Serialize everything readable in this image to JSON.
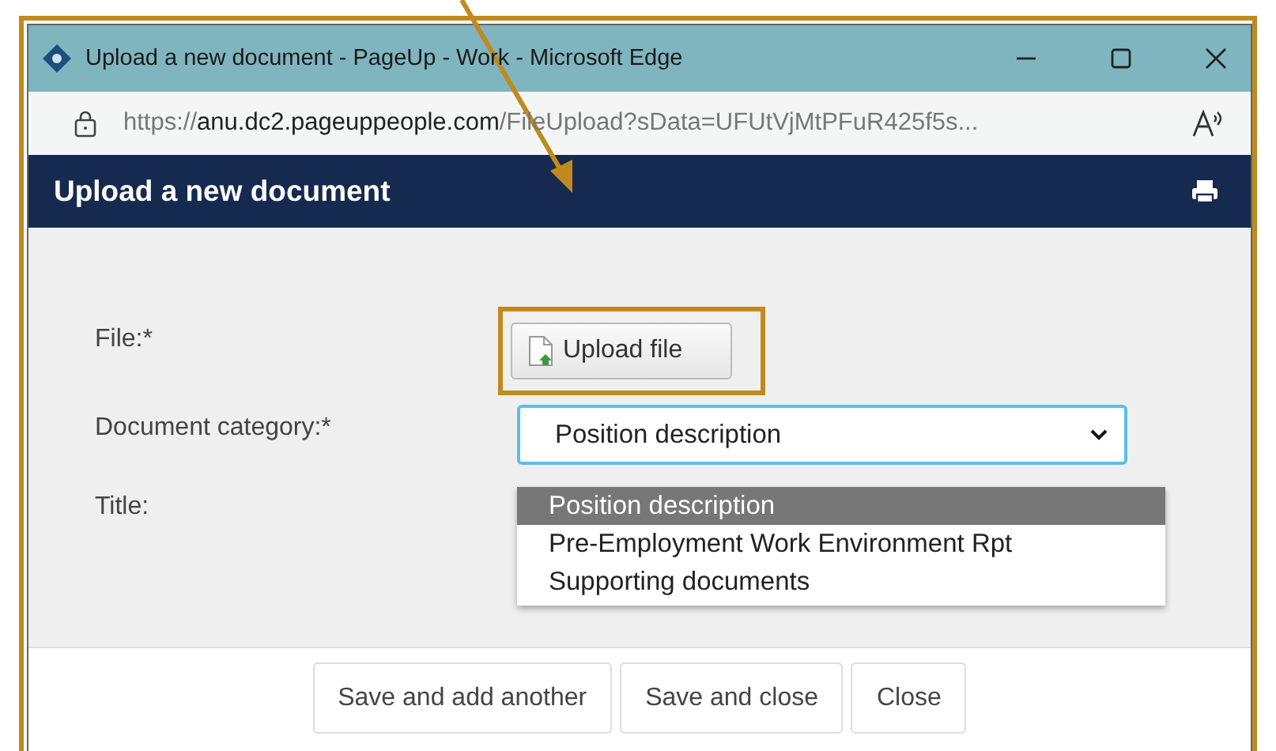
{
  "window": {
    "title": "Upload a new document - PageUp - Work - Microsoft Edge"
  },
  "address_bar": {
    "scheme": "https://",
    "host": "anu.dc2.pageuppeople.com",
    "path": "/FileUpload?sData=UFUtVjMtPFuR425f5s..."
  },
  "header": {
    "title": "Upload a new document"
  },
  "form": {
    "file_label": "File:*",
    "upload_button": "Upload file",
    "category_label": "Document category:*",
    "category_value": "Position description",
    "title_label": "Title:",
    "dropdown": {
      "expanded": true,
      "options": [
        {
          "label": "Position description",
          "selected": true
        },
        {
          "label": "Pre-Employment Work Environment Rpt",
          "selected": false
        },
        {
          "label": "Supporting documents",
          "selected": false
        }
      ]
    }
  },
  "buttons": [
    "Save and add another",
    "Save and close",
    "Close"
  ]
}
